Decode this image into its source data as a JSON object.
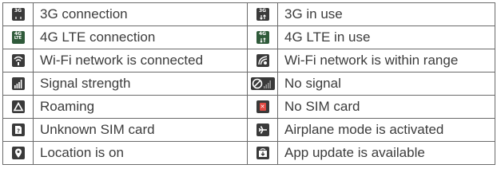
{
  "rows": [
    {
      "left": {
        "icon": "3g-connection-icon",
        "text": "3G connection"
      },
      "right": {
        "icon": "3g-in-use-icon",
        "text": "3G in use"
      }
    },
    {
      "left": {
        "icon": "4g-lte-connection-icon",
        "text": "4G LTE connection"
      },
      "right": {
        "icon": "4g-lte-in-use-icon",
        "text": "4G LTE in use"
      }
    },
    {
      "left": {
        "icon": "wifi-connected-icon",
        "text": "Wi-Fi network is connected"
      },
      "right": {
        "icon": "wifi-in-range-icon",
        "text": "Wi-Fi network is within range"
      }
    },
    {
      "left": {
        "icon": "signal-strength-icon",
        "text": "Signal strength"
      },
      "right": {
        "icon": "no-signal-icon",
        "text": "No signal"
      }
    },
    {
      "left": {
        "icon": "roaming-icon",
        "text": "Roaming"
      },
      "right": {
        "icon": "no-sim-card-icon",
        "text": "No SIM card"
      }
    },
    {
      "left": {
        "icon": "unknown-sim-card-icon",
        "text": "Unknown SIM card"
      },
      "right": {
        "icon": "airplane-mode-icon",
        "text": "Airplane mode is activated"
      }
    },
    {
      "left": {
        "icon": "location-icon",
        "text": "Location is on"
      },
      "right": {
        "icon": "app-update-icon",
        "text": "App update is available"
      }
    }
  ],
  "icon_labels": {
    "g3": "3G",
    "g4": "4G",
    "lte": "LTE"
  },
  "colors": {
    "border": "#6a6a6a",
    "icon": "#3a3a3a",
    "text": "#3c3c3c",
    "sim_alert": "#e14a43"
  }
}
